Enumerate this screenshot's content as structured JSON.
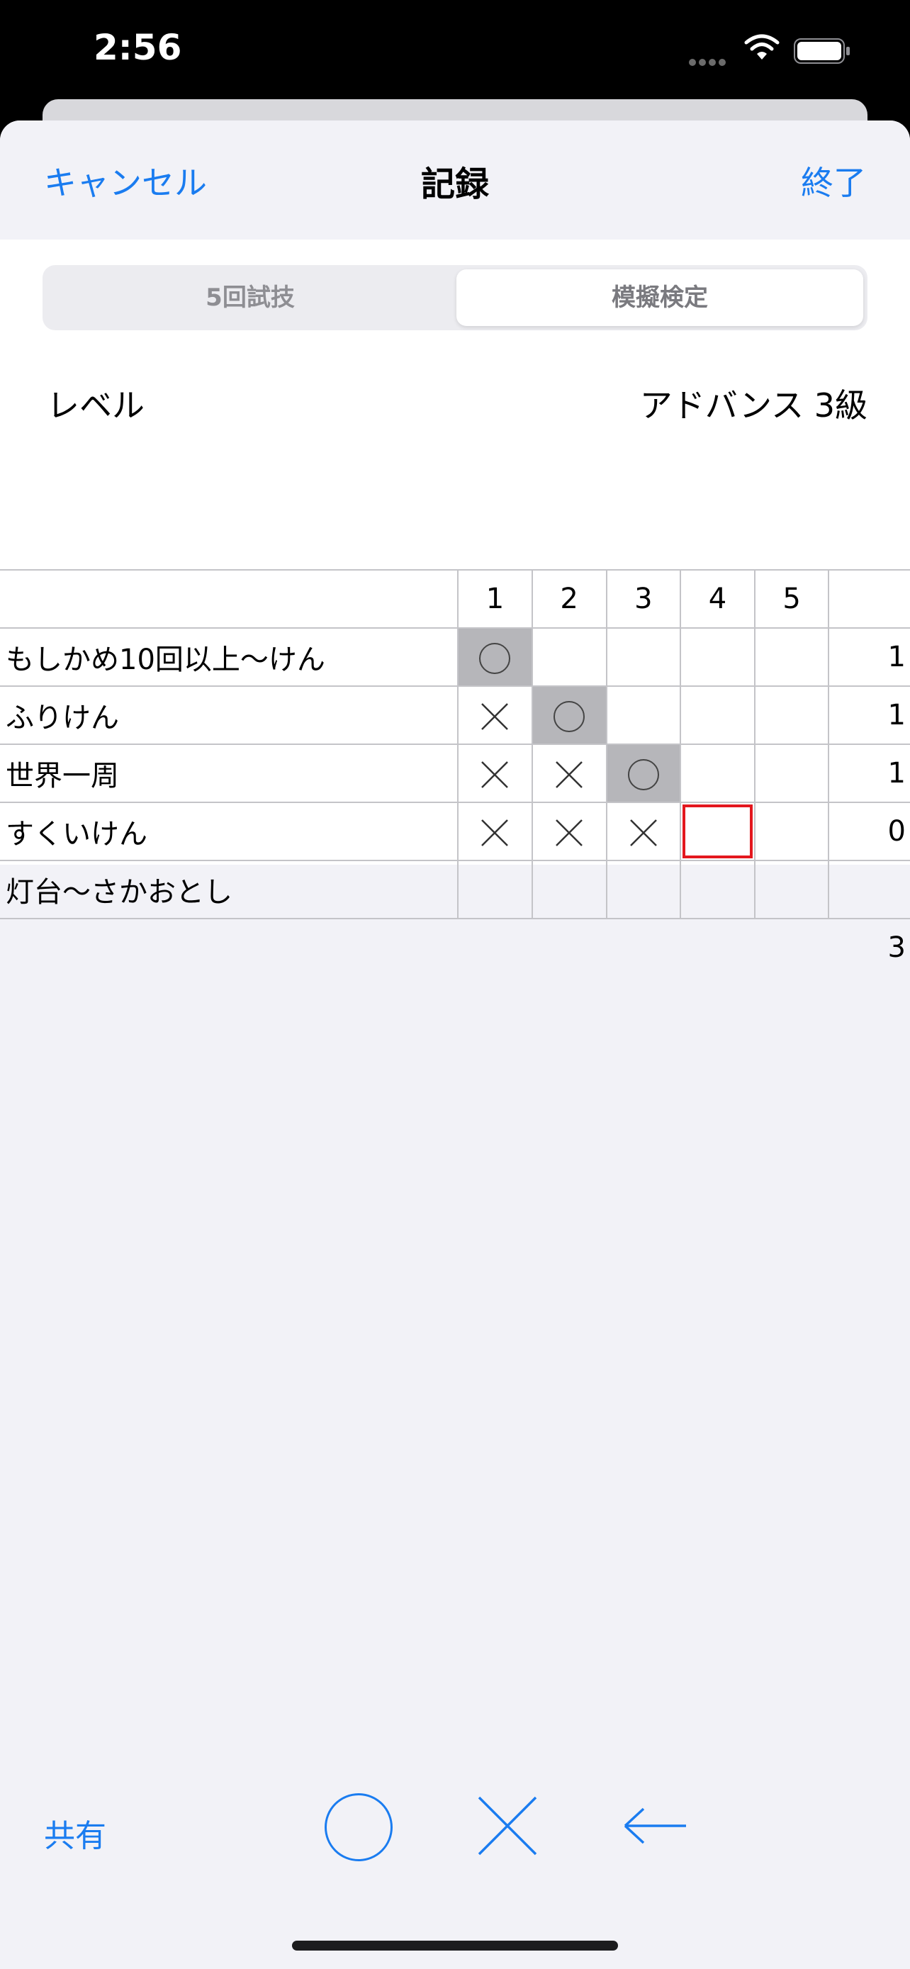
{
  "status": {
    "time": "2:56"
  },
  "nav": {
    "cancel": "キャンセル",
    "title": "記録",
    "done": "終了"
  },
  "segments": [
    "5回試技",
    "模擬検定"
  ],
  "selected_segment": "模擬検定",
  "level": {
    "label": "レベル",
    "value": "アドバンス 3級"
  },
  "table": {
    "columns": [
      "1",
      "2",
      "3",
      "4",
      "5"
    ],
    "rows": [
      {
        "name": "もしかめ10回以上〜けん",
        "marks": [
          "o",
          "",
          "",
          "",
          ""
        ],
        "total": "1"
      },
      {
        "name": "ふりけん",
        "marks": [
          "x",
          "o",
          "",
          "",
          ""
        ],
        "total": "1"
      },
      {
        "name": "世界一周",
        "marks": [
          "x",
          "x",
          "o",
          "",
          ""
        ],
        "total": "1"
      },
      {
        "name": "すくいけん",
        "marks": [
          "x",
          "x",
          "x",
          "",
          ""
        ],
        "total": "0"
      },
      {
        "name": "灯台〜さかおとし",
        "marks": [
          "",
          "",
          "",
          "",
          ""
        ],
        "total": ""
      }
    ],
    "sum": "3"
  },
  "toolbar": {
    "share": "共有"
  },
  "colors": {
    "accent": "#1a7cf0",
    "cursor": "#e3171e",
    "hit_cell": "#b6b6ba"
  }
}
